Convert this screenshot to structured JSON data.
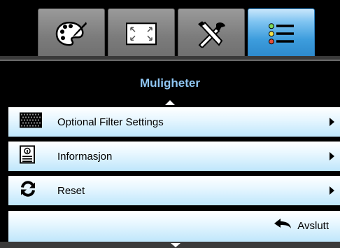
{
  "tabs": [
    {
      "icon": "palette-icon",
      "active": false
    },
    {
      "icon": "screen-resize-icon",
      "active": false
    },
    {
      "icon": "tools-icon",
      "active": false
    },
    {
      "icon": "options-list-icon",
      "active": true
    }
  ],
  "menu": {
    "title": "Muligheter",
    "items": [
      {
        "label": "Optional Filter Settings",
        "icon": "filter-grid-icon"
      },
      {
        "label": "Informasjon",
        "icon": "info-document-icon"
      },
      {
        "label": "Reset",
        "icon": "reset-icon"
      }
    ],
    "exit_label": "Avslutt"
  },
  "colors": {
    "title": "#8fc6f2",
    "active_tab": "#3d9ddd",
    "row_bottom": "#bfe6fb"
  }
}
